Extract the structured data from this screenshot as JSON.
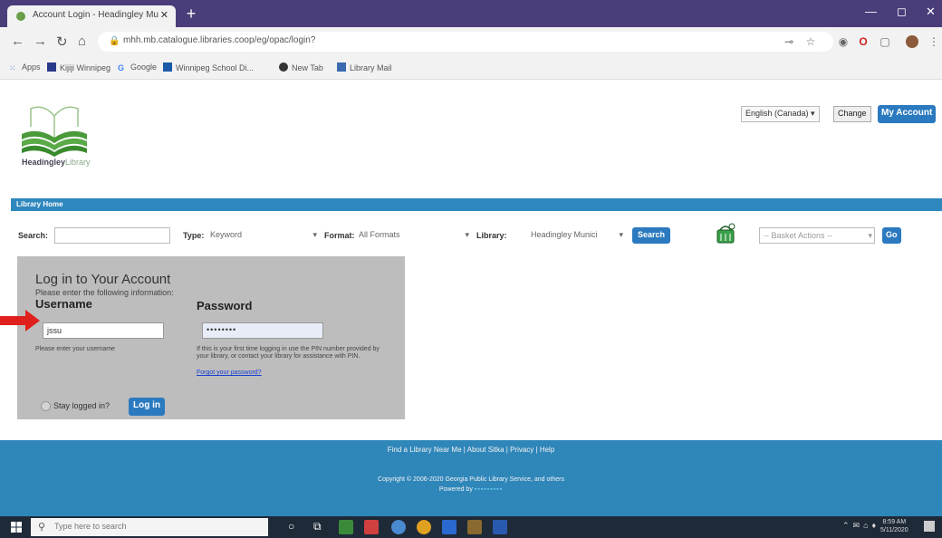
{
  "browser": {
    "tab_title": "Account Login - Headingley Mu",
    "url": "mhh.mb.catalogue.libraries.coop/eg/opac/login?",
    "bookmarks": [
      {
        "label": "Apps"
      },
      {
        "label": "Kijiji Winnipeg"
      },
      {
        "label": "Google"
      },
      {
        "label": "Winnipeg School Di..."
      },
      {
        "label": "New Tab"
      },
      {
        "label": "Library Mail"
      }
    ]
  },
  "header": {
    "logo_name": "Headingley",
    "logo_suffix": "Library",
    "language": "English (Canada) ▾",
    "change_label": "Change",
    "my_account_label": "My Account"
  },
  "nav": {
    "library_home": "Library Home"
  },
  "search": {
    "search_label": "Search:",
    "search_value": "",
    "type_label": "Type:",
    "type_value": "Keyword",
    "format_label": "Format:",
    "format_value": "All Formats",
    "library_label": "Library:",
    "library_value": "Headingley Munici",
    "search_button": "Search",
    "basket_value": "-- Basket Actions --",
    "go_button": "Go"
  },
  "login": {
    "title": "Log in to Your Account",
    "subtitle": "Please enter the following information:",
    "username_label": "Username",
    "username_value": "jssu",
    "username_help": "Please enter your username",
    "password_label": "Password",
    "password_value": "••••••••",
    "password_help": "If this is your first time logging in use the PIN number provided by your library, or contact your library for assistance with PIN.",
    "forgot_link": "Forgot your password?",
    "stay_logged_in": "Stay logged in?",
    "login_button": "Log in"
  },
  "footer": {
    "links": "Find a Library Near Me | About Sitka | Privacy | Help",
    "copyright": "Copyright © 2006-2020 Georgia Public Library Service, and others",
    "powered_by": "Powered by"
  },
  "taskbar": {
    "search_placeholder": "Type here to search",
    "time": "8:59 AM",
    "date": "5/11/2020"
  },
  "colors": {
    "accent_blue": "#2b7ac0",
    "footer_blue": "#2f86b9",
    "panel_grey": "#bdbdbd",
    "arrow_red": "#e0201c"
  }
}
